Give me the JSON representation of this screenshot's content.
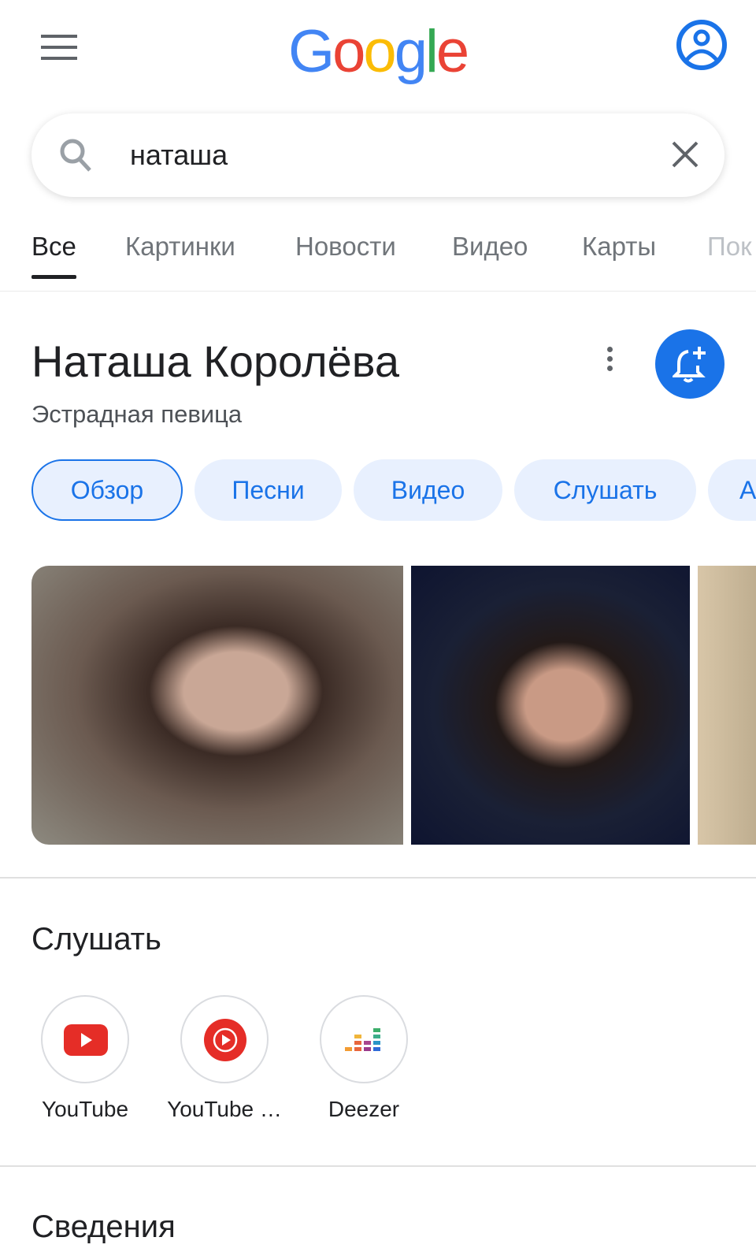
{
  "header": {
    "logo": "Google",
    "menu_icon": "hamburger-icon",
    "account_icon": "account-circle-icon",
    "logo_colors": [
      "#4285f4",
      "#ea4335",
      "#fbbc05",
      "#4285f4",
      "#34a853",
      "#ea4335"
    ]
  },
  "search": {
    "query": "наташа",
    "search_icon": "search-icon",
    "clear_icon": "close-icon"
  },
  "tabs": [
    {
      "label": "Все",
      "active": true
    },
    {
      "label": "Картинки"
    },
    {
      "label": "Новости"
    },
    {
      "label": "Видео"
    },
    {
      "label": "Карты"
    },
    {
      "label": "Пок"
    }
  ],
  "entity": {
    "title": "Наташа Королёва",
    "subtitle": "Эстрадная певица",
    "more_icon": "more-vert-icon",
    "follow_icon": "bell-plus-icon"
  },
  "chips": [
    {
      "label": "Обзор",
      "active": true
    },
    {
      "label": "Песни"
    },
    {
      "label": "Видео"
    },
    {
      "label": "Слушать"
    },
    {
      "label": "А"
    }
  ],
  "listen": {
    "heading": "Слушать",
    "apps": [
      {
        "label": "YouTube",
        "icon": "youtube-icon"
      },
      {
        "label": "YouTube …",
        "icon": "youtube-music-icon"
      },
      {
        "label": "Deezer",
        "icon": "deezer-icon"
      }
    ]
  },
  "info": {
    "heading": "Сведения"
  },
  "colors": {
    "accent": "#1a73e8",
    "chip_bg": "#e8f0fe",
    "youtube_red": "#e52d27"
  }
}
